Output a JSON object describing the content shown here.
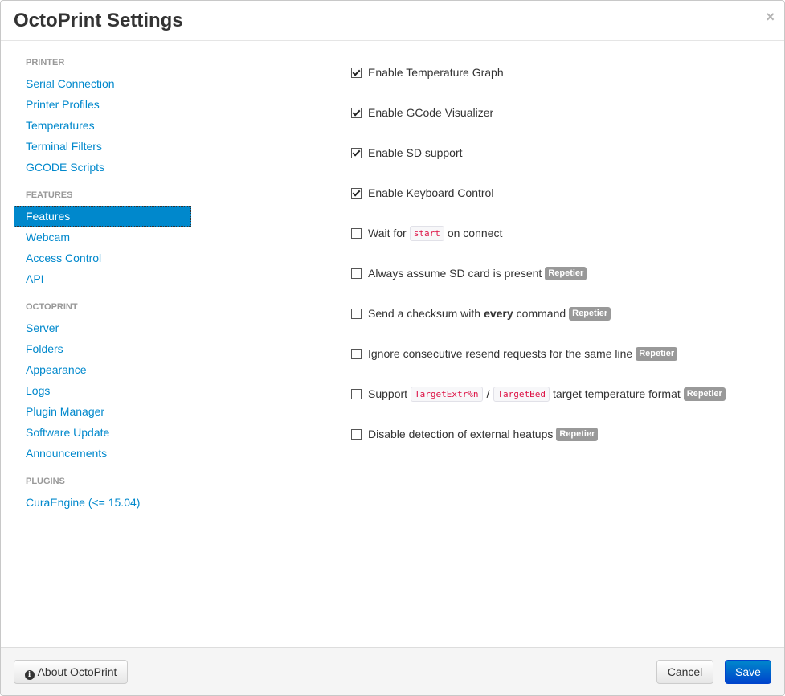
{
  "dialog": {
    "title": "OctoPrint Settings",
    "close_glyph": "×"
  },
  "sidebar": {
    "sections": [
      {
        "header": "PRINTER",
        "items": [
          "Serial Connection",
          "Printer Profiles",
          "Temperatures",
          "Terminal Filters",
          "GCODE Scripts"
        ]
      },
      {
        "header": "FEATURES",
        "items": [
          "Features",
          "Webcam",
          "Access Control",
          "API"
        ]
      },
      {
        "header": "OCTOPRINT",
        "items": [
          "Server",
          "Folders",
          "Appearance",
          "Logs",
          "Plugin Manager",
          "Software Update",
          "Announcements"
        ]
      },
      {
        "header": "PLUGINS",
        "items": [
          "CuraEngine (<= 15.04)"
        ]
      }
    ],
    "active_item": "Features"
  },
  "features": {
    "temperature_graph": {
      "label": "Enable Temperature Graph",
      "checked": true
    },
    "gcode_visualizer": {
      "label": "Enable GCode Visualizer",
      "checked": true
    },
    "sd_support": {
      "label": "Enable SD support",
      "checked": true
    },
    "keyboard_control": {
      "label": "Enable Keyboard Control",
      "checked": true
    },
    "wait_for_start": {
      "label_before": "Wait for",
      "code": "start",
      "label_after": "on connect",
      "checked": false
    },
    "always_sd": {
      "label": "Always assume SD card is present",
      "badge": "Repetier",
      "checked": false
    },
    "checksum": {
      "label_before": "Send a checksum with",
      "emphasis": "every",
      "label_after": "command",
      "badge": "Repetier",
      "checked": false
    },
    "ignore_resend": {
      "label": "Ignore consecutive resend requests for the same line",
      "badge": "Repetier",
      "checked": false
    },
    "target_format": {
      "label_before": "Support",
      "code1": "TargetExtr%n",
      "separator": "/",
      "code2": "TargetBed",
      "label_after": "target temperature format",
      "badge": "Repetier",
      "checked": false
    },
    "external_heatups": {
      "label": "Disable detection of external heatups",
      "badge": "Repetier",
      "checked": false
    }
  },
  "footer": {
    "about_label": "About OctoPrint",
    "about_icon": "info-circle-icon",
    "cancel_label": "Cancel",
    "save_label": "Save"
  },
  "colors": {
    "link": "#0088cc",
    "active_bg": "#0088cc",
    "badge_bg": "#999999",
    "code_text": "#dd1144",
    "save_bg": "#0044cc"
  }
}
